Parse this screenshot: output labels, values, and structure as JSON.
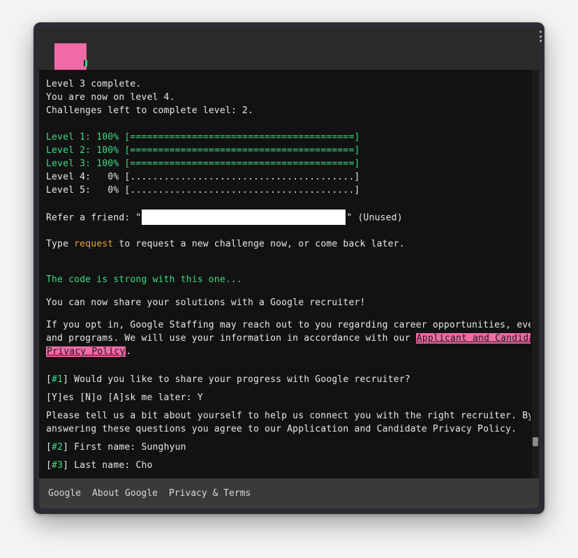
{
  "logo": {
    "color": "#f06aa6"
  },
  "status": {
    "line1": "Level 3 complete.",
    "line2": "You are now on level 4.",
    "line3": "Challenges left to complete level: 2."
  },
  "levels": [
    {
      "label": "Level 1:",
      "percent": "100%",
      "bar": "[========================================]",
      "complete": true
    },
    {
      "label": "Level 2:",
      "percent": "100%",
      "bar": "[========================================]",
      "complete": true
    },
    {
      "label": "Level 3:",
      "percent": "100%",
      "bar": "[========================================]",
      "complete": true
    },
    {
      "label": "Level 4:",
      "percent": "  0%",
      "bar": "[........................................]",
      "complete": false
    },
    {
      "label": "Level 5:",
      "percent": "  0%",
      "bar": "[........................................]",
      "complete": false
    }
  ],
  "refer": {
    "prefix": "Refer a friend: \"",
    "suffix": "\" (Unused)"
  },
  "request": {
    "before": "Type ",
    "command": "request",
    "after": " to request a new challenge now, or come back later."
  },
  "strong": "The code is strong with this one...",
  "share_intro": "You can now share your solutions with a Google recruiter!",
  "optin": {
    "line1": "If you opt in, Google Staffing may reach out to you regarding career opportunities, events,",
    "line2_before": "and programs. We will use your information in accordance with our ",
    "link_part1": "Applicant and Candidate",
    "link_part2": "Privacy Policy",
    "line3_after": "."
  },
  "q1": {
    "num": "#1",
    "text": " Would you like to share your progress with Google recruiter?"
  },
  "answer1": "[Y]es [N]o [A]sk me later: Y",
  "tell": {
    "line1": "Please tell us a bit about yourself to help us connect you with the right recruiter. By",
    "line2": "answering these questions you agree to our Application and Candidate Privacy Policy."
  },
  "q2": {
    "num": "#2",
    "text": " First name: Sunghyun"
  },
  "q3": {
    "num": "#3",
    "text": " Last name: Cho"
  },
  "footer": {
    "links": [
      "Google",
      "About Google",
      "Privacy & Terms"
    ]
  },
  "colors": {
    "accent_green": "#3ddc84",
    "accent_pink": "#f06aa6",
    "accent_gold": "#e6a93a",
    "background": "#121212"
  }
}
